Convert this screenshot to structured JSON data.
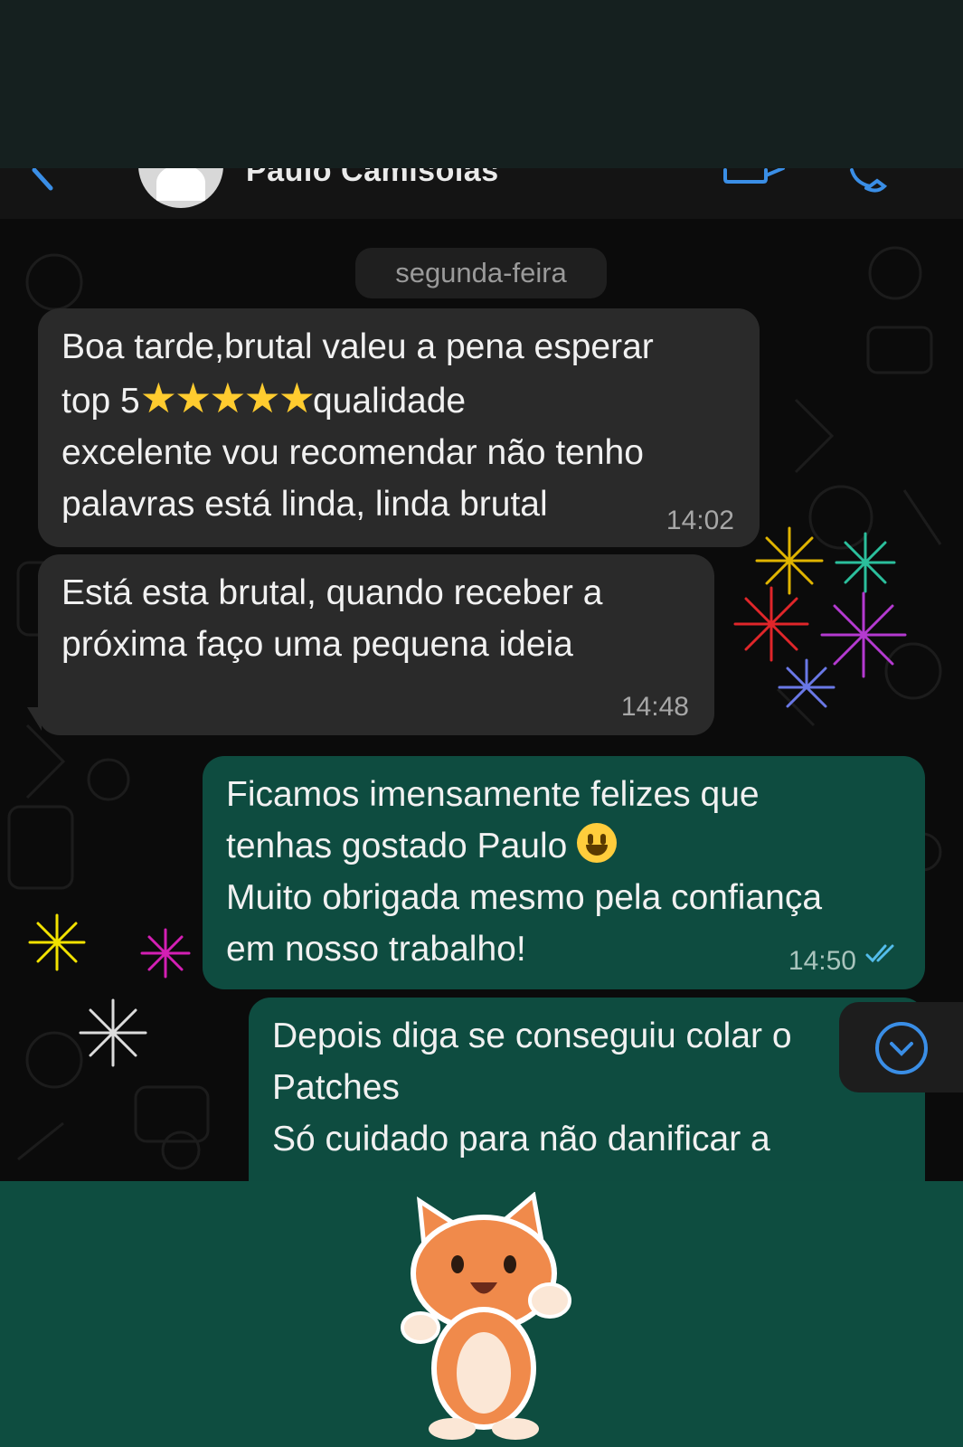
{
  "header": {
    "contact_name": "Paulo Camisolas",
    "icons": [
      "back-arrow-icon",
      "avatar",
      "video-call-icon",
      "voice-call-icon"
    ]
  },
  "chat": {
    "date_chip": "segunda-feira",
    "messages": [
      {
        "direction": "incoming",
        "lines": [
          "Boa tarde,brutal valeu a pena esperar",
          "top 5",
          "qualidade",
          "excelente vou recomendar não tenho",
          "palavras está linda, linda brutal"
        ],
        "stars": "★★★★★",
        "time": "14:02"
      },
      {
        "direction": "incoming",
        "lines": [
          "Está esta brutal, quando receber a",
          "próxima faço uma pequena ideia"
        ],
        "time": "14:48"
      },
      {
        "direction": "outgoing",
        "lines": [
          "Ficamos imensamente felizes que",
          "tenhas gostado Paulo",
          "Muito obrigada mesmo pela confiança",
          "em nosso trabalho!"
        ],
        "time": "14:50",
        "status": "read-double-tick-icon"
      },
      {
        "direction": "outgoing",
        "lines": [
          "Depois diga se conseguiu colar o",
          "Patches",
          "Só cuidado para não danificar a"
        ]
      }
    ]
  },
  "colors": {
    "incoming_bubble": "#2a2a2a",
    "outgoing_bubble": "#0e4c40",
    "accent": "#3a8ee6",
    "bottom_panel": "#0e4d40"
  },
  "decorations": [
    "fireworks-gif",
    "cat-waving-sticker"
  ]
}
